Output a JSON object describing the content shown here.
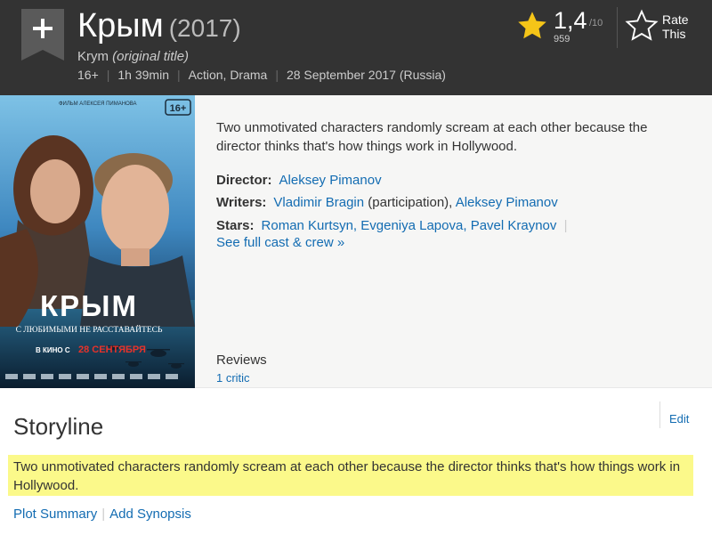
{
  "header": {
    "title": "Крым",
    "year": "(2017)",
    "original_title": "Krym",
    "original_title_note": "(original title)",
    "certificate": "16+",
    "runtime": "1h 39min",
    "genres": "Action, Drama",
    "release_date": "28 September 2017 (Russia)",
    "separator": "|"
  },
  "rating": {
    "value": "1,4",
    "best": "/10",
    "count": "959",
    "rate_line1": "Rate",
    "rate_line2": "This"
  },
  "poster": {
    "top_credit": "ФИЛЬМ АЛЕКСЕЯ ПИМАНОВА",
    "age_badge": "16+",
    "title": "КРЫМ",
    "tagline": "С ЛЮБИМЫМИ НЕ РАССТАВАЙТЕСЬ",
    "release_prefix": "В КИНО С",
    "release_date": "28 СЕНТЯБРЯ"
  },
  "summary": "Two unmotivated characters randomly scream at each other because the director thinks that's how things work in Hollywood.",
  "credits": {
    "director_label": "Director:",
    "director": "Aleksey Pimanov",
    "writers_label": "Writers:",
    "writer1": "Vladimir Bragin",
    "writer1_note": "(participation),",
    "writer2": "Aleksey Pimanov",
    "stars_label": "Stars:",
    "star1": "Roman Kurtsyn,",
    "star2": "Evgeniya Lapova,",
    "star3": "Pavel Kraynov",
    "separator": "|",
    "see_full_cast": "See full cast & crew »"
  },
  "reviews": {
    "label": "Reviews",
    "critic_link": "1 critic"
  },
  "storyline": {
    "heading": "Storyline",
    "edit": "Edit",
    "text": "Two unmotivated characters randomly scream at each other because the director thinks that's how things work in Hollywood.",
    "plot_summary_link": "Plot Summary",
    "separator": "|",
    "add_synopsis_link": "Add Synopsis"
  },
  "colors": {
    "header_bg": "#333333",
    "star": "#f5c518",
    "link": "#136cb2",
    "highlight": "#fbf98a",
    "poster_release_date": "#e8322a"
  },
  "icons": {
    "watchlist": "add-to-watchlist-ribbon-icon",
    "rating": "star-filled-icon",
    "rate": "star-outline-icon"
  }
}
